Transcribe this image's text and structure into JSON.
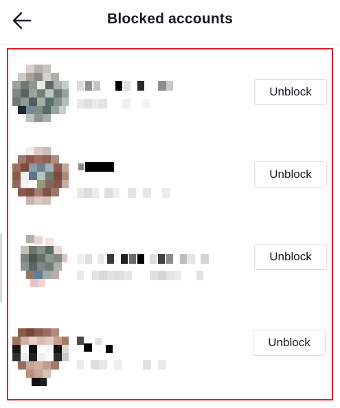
{
  "header": {
    "title": "Blocked accounts",
    "back_icon": "arrow-left-icon"
  },
  "highlight_color": "#e31b23",
  "accounts": [
    {
      "unblock_label": "Unblock",
      "avatar": "pixelated-avatar",
      "name": "pixelated",
      "handle": "pixelated"
    },
    {
      "unblock_label": "Unblock",
      "avatar": "pixelated-avatar",
      "name": "pixelated",
      "handle": "pixelated"
    },
    {
      "unblock_label": "Unblock",
      "avatar": "pixelated-avatar",
      "name": "pixelated",
      "handle": "pixelated"
    },
    {
      "unblock_label": "Unblock",
      "avatar": "pixelated-avatar",
      "name": "pixelated",
      "handle": "pixelated"
    }
  ]
}
